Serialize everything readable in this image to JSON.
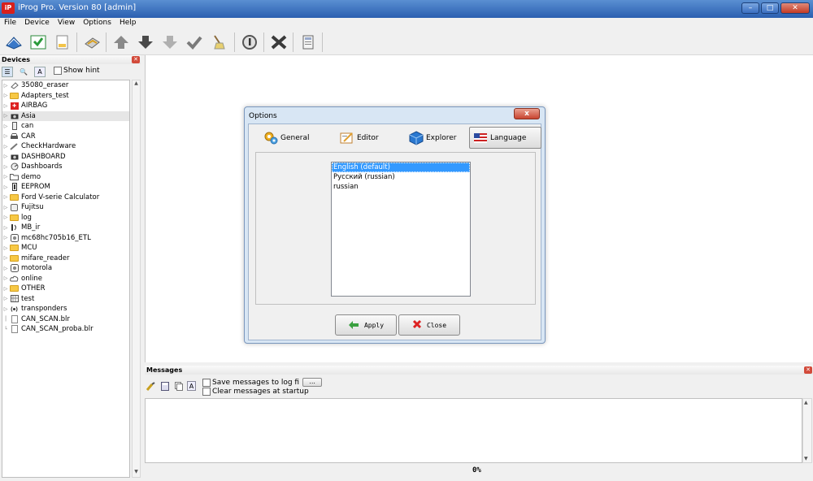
{
  "window": {
    "title": "iProg Pro. Version 80 [admin]",
    "app_icon_text": "iP"
  },
  "menu": [
    "File",
    "Device",
    "View",
    "Options",
    "Help"
  ],
  "toolbar": {
    "icons": [
      "open-book-icon",
      "save-icon",
      "new-file-icon",
      "chip-icon",
      "arrow-up-icon",
      "arrow-down-icon",
      "arrow-down-gray-icon",
      "check-icon",
      "broom-icon",
      "info-icon",
      "cross-icon",
      "calculator-icon"
    ]
  },
  "devices": {
    "header": "Devices",
    "show_hint_label": "Show hint",
    "items": [
      {
        "label": "35080_eraser",
        "icon": "eraser-icon"
      },
      {
        "label": "Adapters_test",
        "icon": "folder-icon"
      },
      {
        "label": "AIRBAG",
        "icon": "airbag-icon"
      },
      {
        "label": "Asia",
        "icon": "camera-icon",
        "selected": true
      },
      {
        "label": "can",
        "icon": "device-icon"
      },
      {
        "label": "CAR",
        "icon": "car-icon"
      },
      {
        "label": "CheckHardware",
        "icon": "pen-icon"
      },
      {
        "label": "DASHBOARD",
        "icon": "camera-icon"
      },
      {
        "label": "Dashboards",
        "icon": "gauge-icon"
      },
      {
        "label": "demo",
        "icon": "folder-outline-icon"
      },
      {
        "label": "EEPROM",
        "icon": "chip-icon"
      },
      {
        "label": "Ford V-serie Calculator",
        "icon": "folder-icon"
      },
      {
        "label": "Fujitsu",
        "icon": "chip-outline-icon"
      },
      {
        "label": "log",
        "icon": "folder-icon"
      },
      {
        "label": "MB_ir",
        "icon": "ir-icon"
      },
      {
        "label": "mc68hc705b16_ETL",
        "icon": "chip-round-icon"
      },
      {
        "label": "MCU",
        "icon": "folder-icon"
      },
      {
        "label": "mifare_reader",
        "icon": "folder-icon"
      },
      {
        "label": "motorola",
        "icon": "chip-round-icon"
      },
      {
        "label": "online",
        "icon": "cloud-icon"
      },
      {
        "label": "OTHER",
        "icon": "folder-icon"
      },
      {
        "label": "test",
        "icon": "grid-icon"
      },
      {
        "label": "transponders",
        "icon": "signal-icon"
      },
      {
        "label": "CAN_SCAN.blr",
        "icon": "document-icon"
      },
      {
        "label": "CAN_SCAN_proba.blr",
        "icon": "document-icon"
      }
    ]
  },
  "dialog": {
    "title": "Options",
    "close_label": "x",
    "tabs": [
      {
        "label": "General",
        "icon": "gears-icon"
      },
      {
        "label": "Editor",
        "icon": "editor-icon"
      },
      {
        "label": "Explorer",
        "icon": "cube-icon"
      },
      {
        "label": "Language",
        "icon": "flag-icon",
        "active": true
      }
    ],
    "languages": [
      {
        "label": "English (default)",
        "selected": true
      },
      {
        "label": "Русский (russian)"
      },
      {
        "label": "russian"
      }
    ],
    "apply_label": "Apply",
    "close_button_label": "Close"
  },
  "messages": {
    "header": "Messages",
    "save_to_log_label": "Save messages to log fi",
    "browse_label": "...",
    "clear_at_startup_label": "Clear messages at startup",
    "progress": "0%"
  },
  "colors": {
    "selection": "#3399ff",
    "titlebar": "#2a5fb0",
    "folder": "#f7c844"
  }
}
